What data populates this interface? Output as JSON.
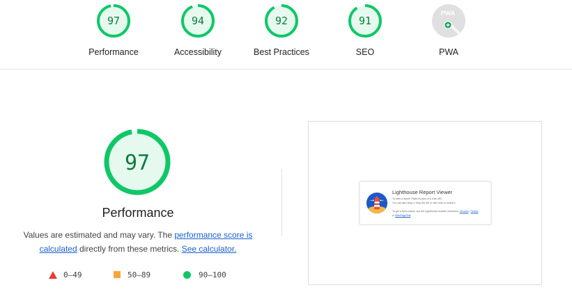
{
  "categories": [
    {
      "score": "97",
      "label": "Performance",
      "fraction": 0.97,
      "icon": "score-gauge"
    },
    {
      "score": "94",
      "label": "Accessibility",
      "fraction": 0.94,
      "icon": "score-gauge"
    },
    {
      "score": "92",
      "label": "Best Practices",
      "fraction": 0.92,
      "icon": "score-gauge"
    },
    {
      "score": "91",
      "label": "SEO",
      "fraction": 0.91,
      "icon": "score-gauge"
    }
  ],
  "pwa": {
    "badge_text": "PWA",
    "label": "PWA",
    "icon": "pwa-badge-icon"
  },
  "performance": {
    "score": "97",
    "fraction": 0.97,
    "title": "Performance",
    "desc_prefix": "Values are estimated and may vary. The ",
    "link_score": "performance score is calculated",
    "desc_middle": " directly from these metrics. ",
    "link_calc": "See calculator."
  },
  "legend": [
    {
      "range": "0–49",
      "shape": "triangle",
      "color": "#eb3b35"
    },
    {
      "range": "50–89",
      "shape": "square",
      "color": "#f9a43c"
    },
    {
      "range": "90–100",
      "shape": "circle",
      "color": "#10c768"
    }
  ],
  "screenshot": {
    "title": "Lighthouse Report Viewer",
    "line1": "To view a report: Paste its json or a Gist URL.",
    "line2": "You can also drag 'n' drop the file or click here to select it.",
    "line3": "To get a fresh report, use the Lighthouse browser extension: ",
    "link_chrome": "Chrome",
    "sep": " / ",
    "link_firefox": "Firefox",
    "line4_prefix": "or ",
    "link_webpagetest": "WebPageTest"
  },
  "colors": {
    "pass": "#0c7b3e",
    "pass_ring": "#10c768",
    "pass_fill": "#e6f9ee",
    "pwa_grey": "#e0e0e0"
  }
}
